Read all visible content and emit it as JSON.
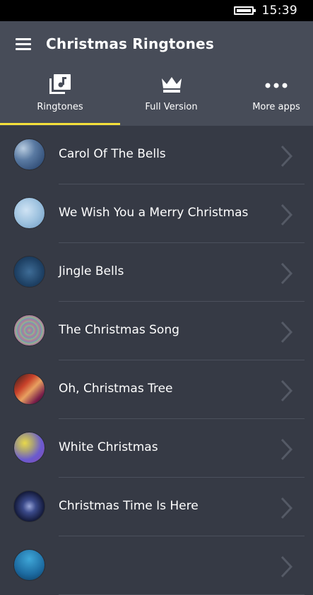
{
  "status_bar": {
    "time": "15:39",
    "battery_icon": "battery-icon"
  },
  "header": {
    "title": "Christmas Ringtones",
    "menu_icon": "hamburger-menu-icon"
  },
  "tabs": [
    {
      "label": "Ringtones",
      "icon": "music-note-icon",
      "selected": true
    },
    {
      "label": "Full Version",
      "icon": "crown-icon",
      "selected": false
    },
    {
      "label": "More apps",
      "icon": "more-dots-icon",
      "selected": false
    }
  ],
  "accent_color": "#f5e03a",
  "songs": [
    {
      "title": "Carol Of The Bells",
      "icon": "chevron-right-icon"
    },
    {
      "title": "We Wish You a Merry Christmas",
      "icon": "chevron-right-icon"
    },
    {
      "title": "Jingle Bells",
      "icon": "chevron-right-icon"
    },
    {
      "title": "The Christmas Song",
      "icon": "chevron-right-icon"
    },
    {
      "title": "Oh, Christmas Tree",
      "icon": "chevron-right-icon"
    },
    {
      "title": "White Christmas",
      "icon": "chevron-right-icon"
    },
    {
      "title": "Christmas Time Is Here",
      "icon": "chevron-right-icon"
    },
    {
      "title": "",
      "icon": "chevron-right-icon"
    }
  ]
}
